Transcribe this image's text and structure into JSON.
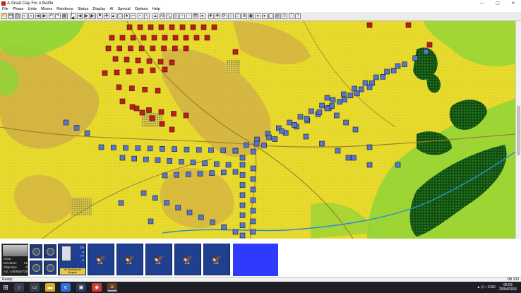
{
  "window": {
    "title": "A Great Day For A Battle",
    "minimize": "—",
    "maximize": "▢",
    "close": "✕"
  },
  "menu": [
    "File",
    "Phase",
    "Units",
    "Moves",
    "Reinforce",
    "Status",
    "Display",
    "AI",
    "Special",
    "Options",
    "Help"
  ],
  "toolbar": {
    "icons": [
      "folder-open-icon",
      "save-icon",
      "print-icon",
      "back-icon",
      "forward-icon",
      "arrow-left-icon",
      "arrow-right-icon",
      "undo-icon",
      "redo-icon",
      "grid-icon",
      "first-icon",
      "prev-icon",
      "next-icon",
      "last-icon",
      "flag-icon",
      "cross-icon",
      "arrow-up-icon",
      "hex-icon",
      "tree-icon",
      "road-icon",
      "river-icon",
      "contour-icon",
      "triangle-icon",
      "ai-icon",
      "search-icon",
      "target-icon",
      "zoom-in-icon",
      "zoom-out-icon",
      "eye-icon",
      "disk-icon",
      "plus-icon",
      "move-icon",
      "rotate-icon",
      "diamond-icon",
      "box-icon",
      "crosshair-icon",
      "unit-icon",
      "dot-icon",
      "dot2-icon",
      "circle-icon",
      "stack-icon",
      "list-icon",
      "info-icon",
      "help-icon"
    ],
    "labels": [
      "📂",
      "💾",
      "🖨",
      "«",
      "»",
      "◀",
      "▶",
      "↶",
      "↷",
      "▦",
      "|◀",
      "◀",
      "▶",
      "▶|",
      "⚑",
      "✚",
      "▲",
      "⬡",
      "♣",
      "═",
      "≈",
      "∿",
      "▲",
      "AI",
      "🔍",
      "◎",
      "+",
      "−",
      "👁",
      "●",
      "✚",
      "✥",
      "⟳",
      "◇",
      "□",
      "⊕",
      "▣",
      "●",
      "●",
      "◯",
      "▤",
      "≡",
      "ⓘ",
      "?"
    ]
  },
  "map": {
    "colors": {
      "clear": "#e8da2c",
      "high": "#caa247",
      "low": "#8fd437",
      "woods": "#124d11",
      "french": "#c8181a",
      "allied": "#5575d5",
      "road": "#9a8530",
      "stream": "#2b8fd0"
    }
  },
  "unit_info": {
    "rows": [
      {
        "label": "Clear",
        "value": ""
      },
      {
        "label": "Elevation",
        "value": "51"
      },
      {
        "label": "Objective",
        "value": "0"
      },
      {
        "label": "Act",
        "value": "445/555/726"
      }
    ]
  },
  "selected_unit": {
    "caption": "de-Ventilasy de Brigade",
    "stats": [
      "375",
      "A",
      "FP",
      "D"
    ]
  },
  "statusbar": {
    "left": "Ready",
    "right": "DB 100"
  },
  "taskbar": {
    "clock_time": "06:03",
    "clock_date": "20/04/2016",
    "tray": "▲  ⊡  ♪  ENG"
  }
}
